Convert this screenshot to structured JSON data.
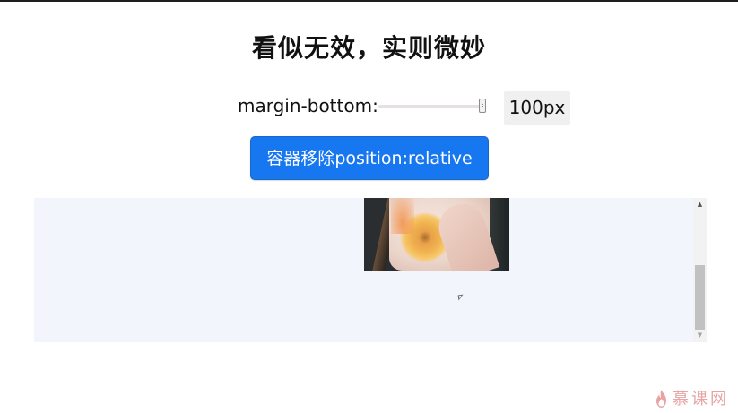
{
  "page": {
    "title": "看似无效，实则微妙"
  },
  "controls": {
    "margin_label": "margin-bottom:",
    "slider_value": 100,
    "slider_unit": "px",
    "value_display": "100px"
  },
  "button": {
    "label": "容器移除position:relative"
  },
  "scrollbar": {
    "up_glyph": "▲",
    "down_glyph": "▼"
  },
  "watermark": {
    "text": "慕课网"
  },
  "colors": {
    "accent": "#1677f1",
    "container_bg": "#f3f5fd",
    "watermark": "#e8a3a3"
  },
  "icons": {
    "cursor": "mouse-pointer-icon",
    "watermark_logo": "flame-logo-icon"
  }
}
